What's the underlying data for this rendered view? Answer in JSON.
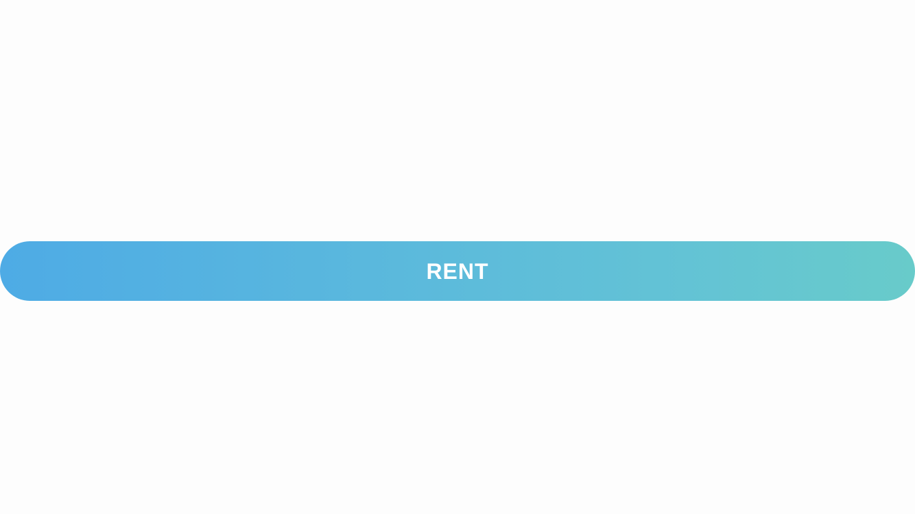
{
  "rent_button": {
    "label": "RENT"
  },
  "colors": {
    "background": "#fdfdfd",
    "button_gradient_start": "#4eabe5",
    "button_gradient_end": "#68cbca",
    "button_text": "#ffffff"
  }
}
